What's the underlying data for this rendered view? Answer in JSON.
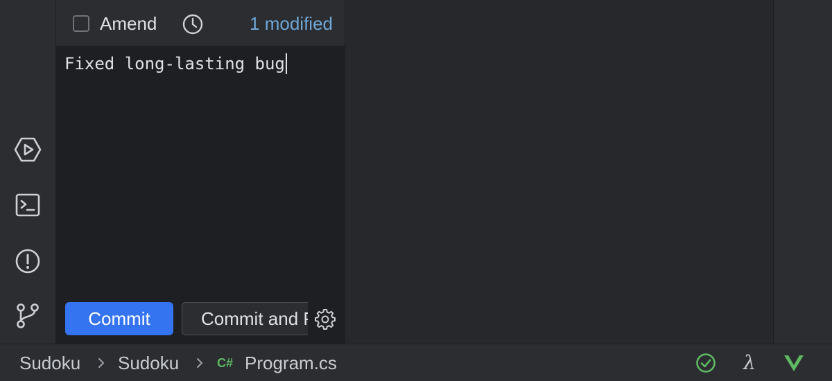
{
  "commit_panel": {
    "amend_label": "Amend",
    "amend_checked": false,
    "modified_label": "1 modified",
    "message": "Fixed long-lasting bug",
    "commit_label": "Commit",
    "commit_push_label": "Commit and Push..."
  },
  "tool_stripe": {
    "items": [
      {
        "name": "run-icon"
      },
      {
        "name": "terminal-icon"
      },
      {
        "name": "problems-icon"
      },
      {
        "name": "git-branch-icon"
      }
    ]
  },
  "status_bar": {
    "breadcrumbs": [
      "Sudoku",
      "Sudoku",
      "Program.cs"
    ],
    "file_lang_badge": "C#",
    "icons": [
      "check-circle-icon",
      "lambda-icon",
      "vue-icon"
    ],
    "lambda_glyph": "λ"
  },
  "colors": {
    "accent": "#3574f0",
    "link": "#6ea7d8",
    "success": "#5fb862",
    "background": "#2b2d30",
    "editor_background": "#1e1f22"
  }
}
